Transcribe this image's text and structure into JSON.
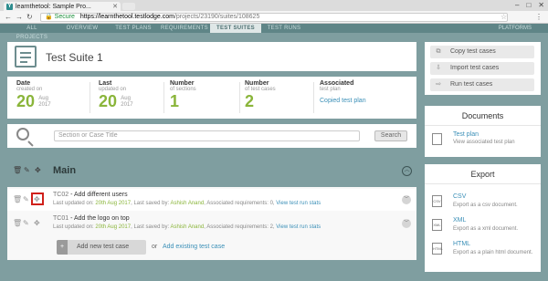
{
  "browser": {
    "tab_title": "learnthetool: Sample Pro...",
    "favicon": "Y",
    "secure_label": "Secure",
    "url_host": "https://learnthetool.testlodge.com",
    "url_path": "/projects/23190/suites/108625",
    "window_controls": [
      "–",
      "□",
      "✕"
    ]
  },
  "app_nav": {
    "items": [
      "ALL PROJECTS",
      "OVERVIEW",
      "TEST PLANS",
      "REQUIREMENTS",
      "TEST SUITES",
      "TEST RUNS"
    ],
    "active": "TEST SUITES",
    "right_item": "PLATFORMS"
  },
  "suite": {
    "title": "Test Suite 1"
  },
  "stats": {
    "date": {
      "label": "Date",
      "sub": "created on",
      "day": "20",
      "month": "Aug",
      "year": "2017"
    },
    "last": {
      "label": "Last",
      "sub": "updated on",
      "day": "20",
      "month": "Aug",
      "year": "2017"
    },
    "sections": {
      "label": "Number",
      "sub": "of sections",
      "value": "1"
    },
    "cases": {
      "label": "Number",
      "sub": "of test cases",
      "value": "2"
    },
    "associated": {
      "label": "Associated",
      "sub": "test plan",
      "link": "Copied test plan"
    }
  },
  "search": {
    "placeholder": "Section or Case Title",
    "button": "Search"
  },
  "section": {
    "title": "Main"
  },
  "cases": [
    {
      "id": "TC02",
      "title": "Add different users",
      "updated_label": "Last updated on:",
      "updated_date": "20th Aug 2017",
      "saved_label": "Last saved by:",
      "saved_by": "Ashish Anand",
      "req_text": "Associated requirements: 0,",
      "runs_link": "View test run stats"
    },
    {
      "id": "TC01",
      "title": "Add the logo on top",
      "updated_label": "Last updated on:",
      "updated_date": "20th Aug 2017",
      "saved_label": "Last saved by:",
      "saved_by": "Ashish Anand",
      "req_text": "Associated requirements: 2,",
      "runs_link": "View test run stats"
    }
  ],
  "add_case": {
    "button": "Add new test case",
    "or": "or",
    "link": "Add existing test case"
  },
  "actions": [
    "Copy test cases",
    "Import test cases",
    "Run test cases"
  ],
  "documents": {
    "title": "Documents",
    "items": [
      {
        "link": "Test plan",
        "desc": "View associated test plan"
      }
    ]
  },
  "export": {
    "title": "Export",
    "items": [
      {
        "link": "CSV",
        "desc": "Export as a csv document.",
        "icon": "CSV"
      },
      {
        "link": "XML",
        "desc": "Export as a xml document.",
        "icon": "XML"
      },
      {
        "link": "HTML",
        "desc": "Export as a plain html document.",
        "icon": "HTML"
      }
    ]
  },
  "colors": {
    "accent_green": "#8ab53a",
    "link_blue": "#3a8fb7",
    "background": "#7f9ea0",
    "highlight_red": "#d0201a"
  },
  "icons": [
    "trash-icon",
    "pencil-icon",
    "move-icon",
    "search-icon",
    "document-icon",
    "collapse-icon",
    "expand-icon"
  ]
}
